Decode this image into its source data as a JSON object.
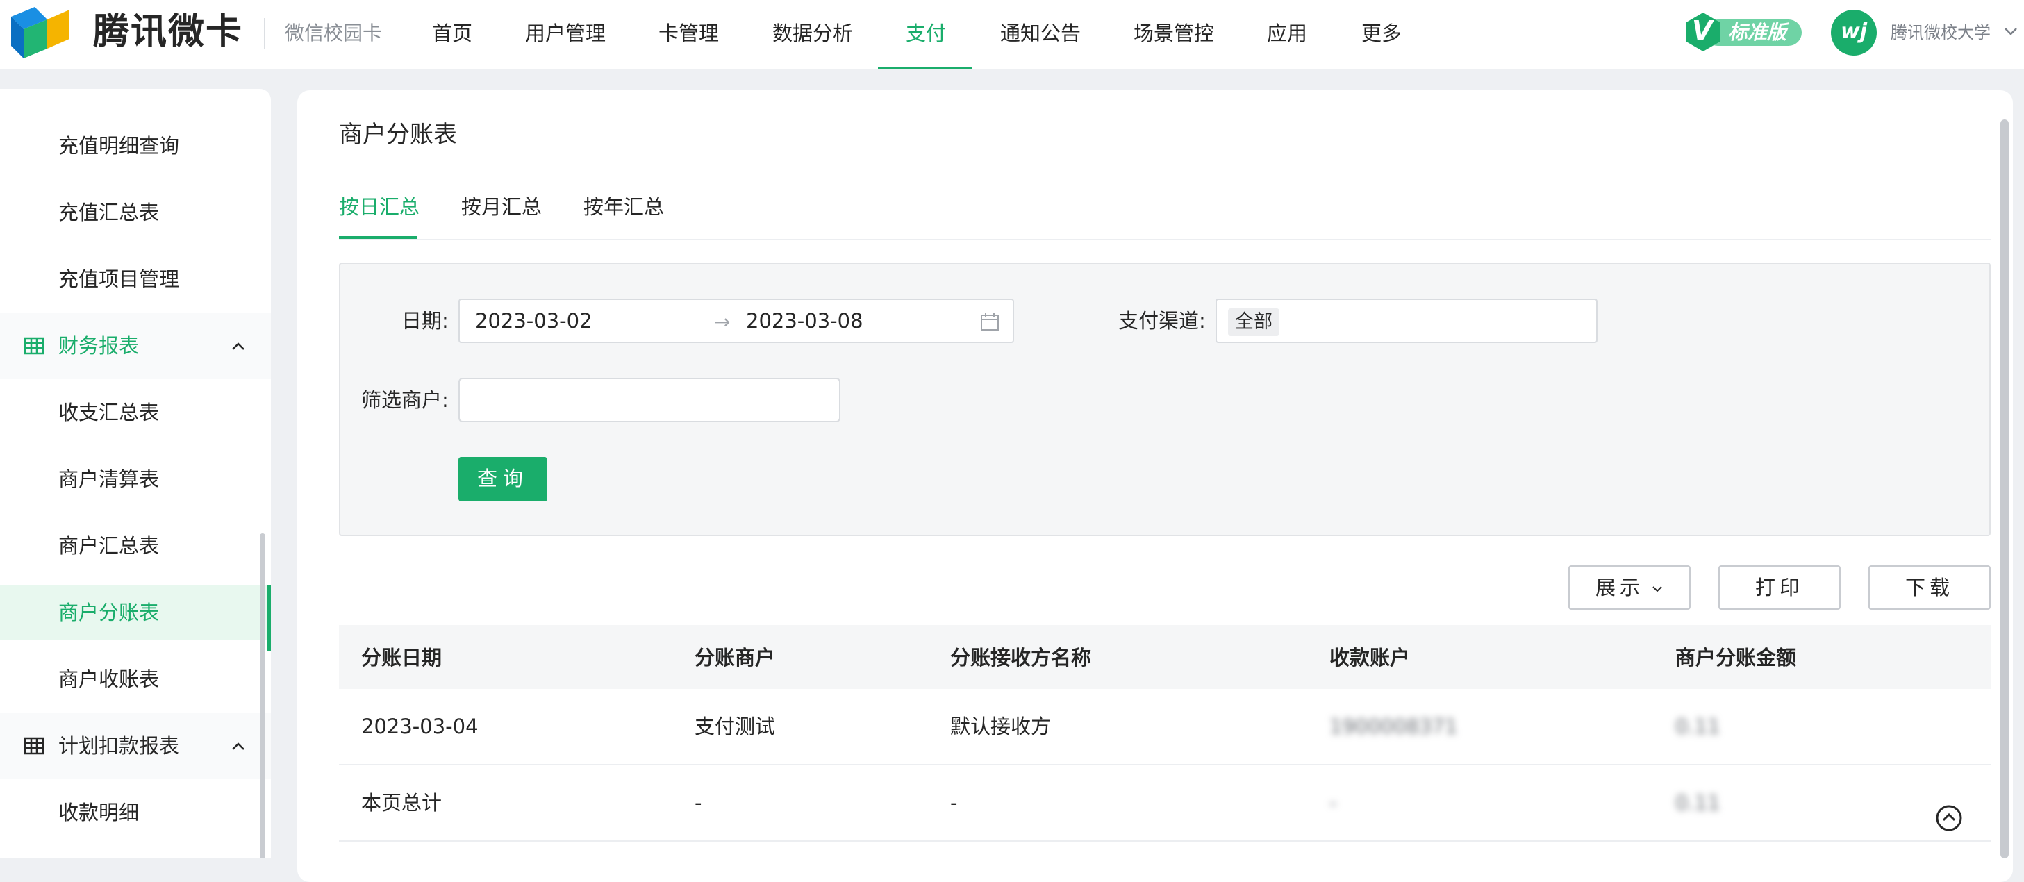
{
  "header": {
    "logo_text": "腾讯微卡",
    "logo_sub": "微信校园卡",
    "nav": [
      {
        "label": "首页"
      },
      {
        "label": "用户管理"
      },
      {
        "label": "卡管理"
      },
      {
        "label": "数据分析"
      },
      {
        "label": "支付",
        "active": true
      },
      {
        "label": "通知公告"
      },
      {
        "label": "场景管控"
      },
      {
        "label": "应用"
      },
      {
        "label": "更多"
      }
    ],
    "edition_badge": "标准版",
    "avatar_text": "wj",
    "org_name": "腾讯微校大学"
  },
  "sidebar": {
    "items": [
      {
        "label": "充值明细查询"
      },
      {
        "label": "充值汇总表"
      },
      {
        "label": "充值项目管理"
      }
    ],
    "group_finance": {
      "label": "财务报表",
      "expanded": true
    },
    "finance_items": [
      {
        "label": "收支汇总表"
      },
      {
        "label": "商户清算表"
      },
      {
        "label": "商户汇总表"
      },
      {
        "label": "商户分账表",
        "active": true
      },
      {
        "label": "商户收账表"
      }
    ],
    "group_plan": {
      "label": "计划扣款报表",
      "expanded": true
    },
    "plan_items": [
      {
        "label": "收款明细"
      }
    ]
  },
  "main": {
    "title": "商户分账表",
    "tabs": [
      {
        "label": "按日汇总",
        "active": true
      },
      {
        "label": "按月汇总"
      },
      {
        "label": "按年汇总"
      }
    ],
    "filters": {
      "date_label": "日期:",
      "date_start": "2023-03-02",
      "date_arrow": "→",
      "date_end": "2023-03-08",
      "channel_label": "支付渠道:",
      "channel_value": "全部",
      "merchant_label": "筛选商户:",
      "merchant_value": "",
      "query_button": "查询"
    },
    "actions": {
      "display": "展示",
      "print": "打印",
      "download": "下载"
    },
    "table": {
      "columns": [
        "分账日期",
        "分账商户",
        "分账接收方名称",
        "收款账户",
        "商户分账金额"
      ],
      "rows": [
        [
          "2023-03-04",
          "支付测试",
          "默认接收方",
          "1900008371",
          "0.11"
        ],
        [
          "本页总计",
          "-",
          "-",
          "-",
          "0.11"
        ]
      ]
    }
  },
  "colors": {
    "accent": "#1aad6b",
    "active_bg": "#e8f8ef",
    "page_bg": "#eef0f3"
  }
}
